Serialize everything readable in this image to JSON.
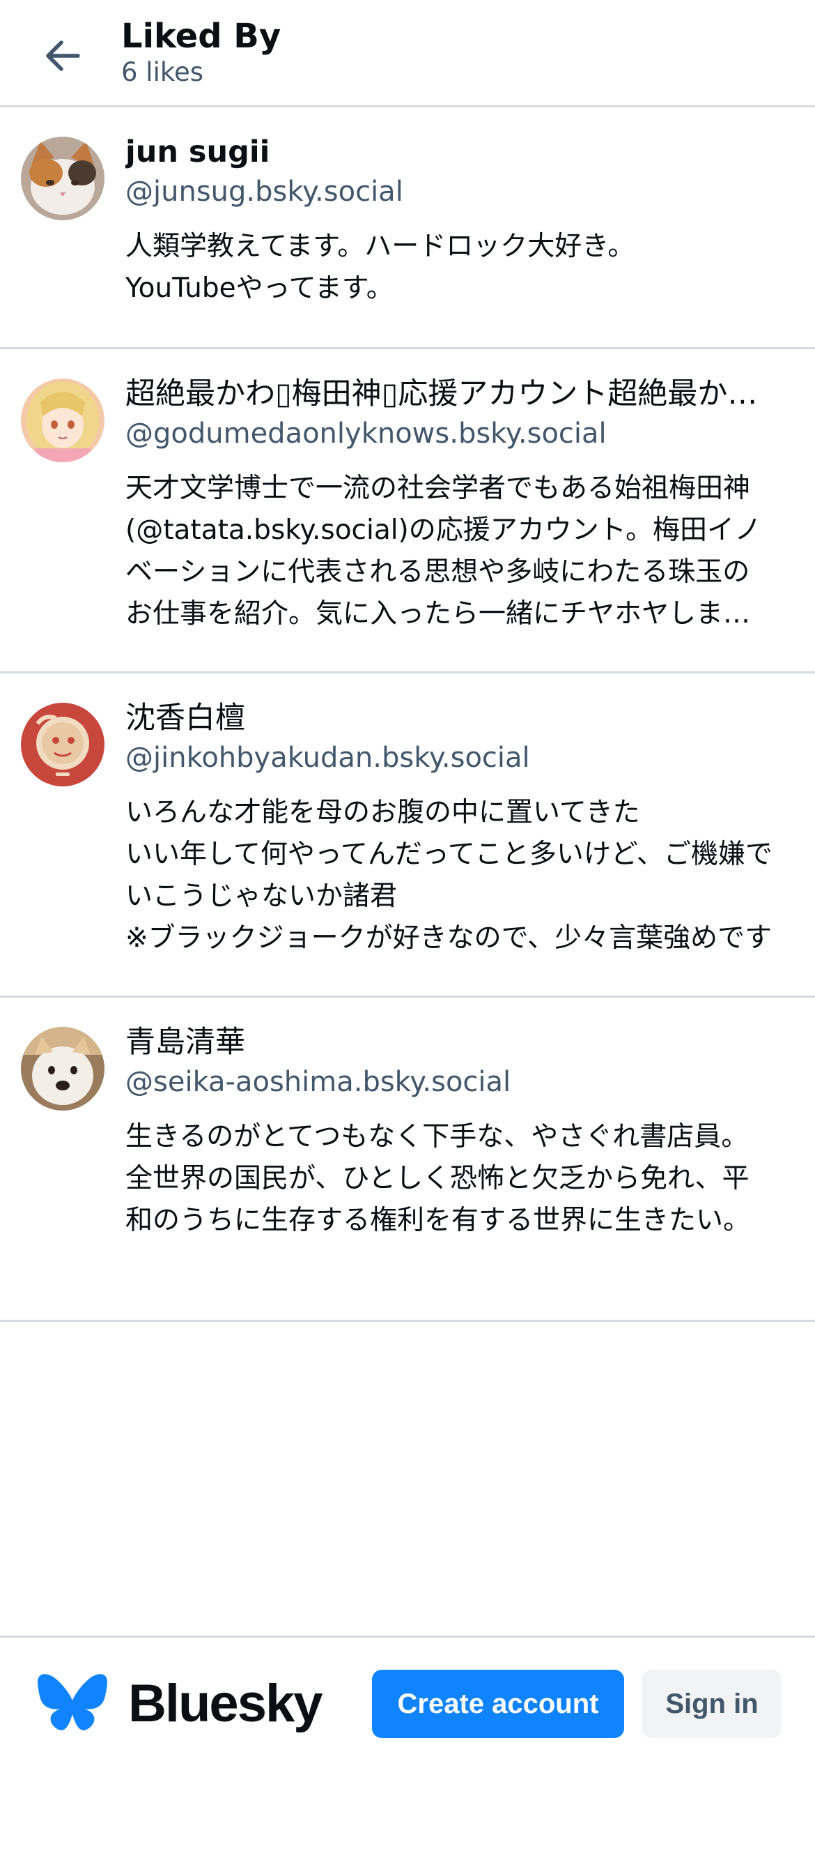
{
  "header": {
    "title": "Liked By",
    "subtitle": "6 likes",
    "back_icon": "arrow-left-icon"
  },
  "likers": [
    {
      "name": "jun sugii",
      "handle": "@junsug.bsky.social",
      "bio": "人類学教えてます。ハードロック大好き。\nYouTubeやってます。",
      "avatar": "cat-avatar"
    },
    {
      "name": "超絶最かわ▯梅田神▯応援アカウント超絶最かわ▯梅田神▯応援アカウント",
      "handle": "@godumedaonlyknows.bsky.social",
      "bio": "天才文学博士で一流の社会学者でもある始祖梅田神(@tatata.bsky.social)の応援アカウント。梅田イノベーションに代表される思想や多岐にわたる珠玉のお仕事を紹介。気に入ったら一緒にチヤホヤしましょう。",
      "avatar": "anime-girl-avatar"
    },
    {
      "name": "沈香白檀",
      "handle": "@jinkohbyakudan.bsky.social",
      "bio": "いろんな才能を母のお腹の中に置いてきた\nいい年して何やってんだってこと多いけど、ご機嫌でいこうじゃないか諸君\n※ブラックジョークが好きなので、少々言葉強めです",
      "avatar": "red-badge-avatar"
    },
    {
      "name": "青島清華",
      "handle": "@seika-aoshima.bsky.social",
      "bio": "生きるのがとてつもなく下手な、やさぐれ書店員。\n全世界の国民が、ひとしく恐怖と欠乏から免れ、平和のうちに生存する権利を有する世界に生きたい。",
      "avatar": "dog-avatar"
    }
  ],
  "footer": {
    "brand": "Bluesky",
    "logo_icon": "butterfly-icon",
    "create_account": "Create account",
    "sign_in": "Sign in"
  },
  "colors": {
    "accent": "#1083fe",
    "muted_text": "#42576c",
    "divider": "#d4dbe2"
  }
}
